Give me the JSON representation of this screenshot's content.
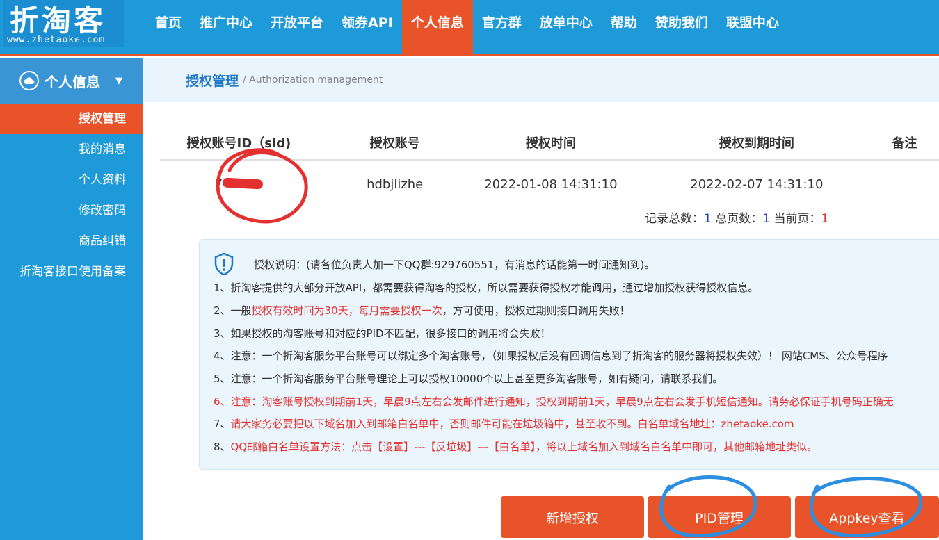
{
  "logo": {
    "text": "折淘客",
    "url": "www.zhetaoke.com"
  },
  "nav": [
    {
      "label": "首页"
    },
    {
      "label": "推广中心"
    },
    {
      "label": "开放平台"
    },
    {
      "label": "领券API"
    },
    {
      "label": "个人信息"
    },
    {
      "label": "官方群"
    },
    {
      "label": "放单中心"
    },
    {
      "label": "帮助"
    },
    {
      "label": "赞助我们"
    },
    {
      "label": "联盟中心"
    }
  ],
  "sidebar": {
    "header": "个人信息",
    "items": [
      {
        "label": "授权管理"
      },
      {
        "label": "我的消息"
      },
      {
        "label": "个人资料"
      },
      {
        "label": "修改密码"
      },
      {
        "label": "商品纠错"
      },
      {
        "label": "折淘客接口使用备案"
      }
    ]
  },
  "breadcrumb": {
    "title": "授权管理",
    "sub": " / Authorization management"
  },
  "table": {
    "headers": [
      "授权账号ID（sid)",
      "授权账号",
      "授权时间",
      "授权到期时间",
      "备注"
    ],
    "row": {
      "sid": "7",
      "account": "hdbjlizhe",
      "auth_time": "2022-01-08 14:31:10",
      "expire_time": "2022-02-07 14:31:10",
      "remark": ""
    }
  },
  "paging": {
    "total_label": "记录总数：",
    "total": "1",
    "pages_label": " 总页数：",
    "pages": "1",
    "current_label": " 当前页：",
    "current": "1"
  },
  "notice": {
    "head": "授权说明：(请各位负责人加一下QQ群:929760551，有消息的话能第一时间通知到)。",
    "l1": "1、折淘客提供的大部分开放API，都需要获得淘客的授权，所以需要获得授权才能调用，通过增加授权获得授权信息。",
    "l2_a": "2、一般",
    "l2_b": "授权有效时间为30天，每月需要授权一次",
    "l2_c": "，方可使用，授权过期则接口调用失败！",
    "l3": "3、如果授权的淘客账号和对应的PID不匹配，很多接口的调用将会失败！",
    "l4": "4、注意：一个折淘客服务平台账号可以绑定多个淘客账号，（如果授权后没有回调信息到了折淘客的服务器将授权失效）！ 网站CMS、公众号程序",
    "l5": "5、注意：一个折淘客服务平台账号理论上可以授权10000个以上甚至更多淘客账号，如有疑问，请联系我们。",
    "l6": "6、注意：淘客账号授权到期前1天，早晨9点左右会发邮件进行通知，授权到期前1天，早晨9点左右会发手机短信通知。请务必保证手机号码正确无",
    "l7_a": "7、",
    "l7_b": "请大家务必要把以下域名加入到邮箱白名单中，否则邮件可能在垃圾箱中，甚至收不到。白名单域名地址：zhetaoke.com",
    "l8_a": "8、",
    "l8_b": "QQ邮箱白名单设置方法：点击【设置】---【反垃圾】---【白名单】，将以上域名加入到域名白名单中即可，其他邮箱地址类似。"
  },
  "buttons": {
    "add": "新增授权",
    "pid": "PID管理",
    "appkey": "Appkey查看"
  },
  "colors": {
    "nav_bg": "#1e9ad9",
    "accent": "#e8532a",
    "red_note": "#e53030",
    "blue_circle": "#2b8ee0"
  }
}
